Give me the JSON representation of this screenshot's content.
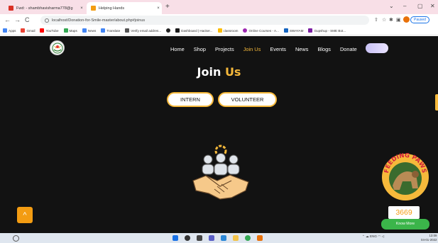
{
  "browser": {
    "tabs": [
      {
        "title": "Fwd: - shambhavisharma778@g",
        "favicon_color": "#d93025",
        "active": false
      },
      {
        "title": "Helping Hands",
        "favicon_color": "#f39c12",
        "active": true
      }
    ],
    "close_glyph": "×",
    "new_tab_glyph": "+",
    "window_controls": [
      "⌄",
      "–",
      "▢",
      "✕"
    ],
    "url": "localhost/Donation-for-Smile-master/about.php#joinus",
    "nav_back": "←",
    "nav_forward": "→",
    "nav_reload": "C",
    "paused_label": "Paused",
    "bookmarks": [
      {
        "label": "Apps",
        "color": "#4285f4"
      },
      {
        "label": "Gmail",
        "color": "#ea4335"
      },
      {
        "label": "YouTube",
        "color": "#ff0000"
      },
      {
        "label": "Maps",
        "color": "#34a853"
      },
      {
        "label": "News",
        "color": "#4285f4"
      },
      {
        "label": "Translate",
        "color": "#4285f4"
      },
      {
        "label": "Verify email addres...",
        "color": "#555555"
      },
      {
        "label": "",
        "color": "#222222"
      },
      {
        "label": "Dashboard | Hacker...",
        "color": "#1a1a1a"
      },
      {
        "label": "classroom",
        "color": "#fbbc04"
      },
      {
        "label": "Online Courses - A...",
        "color": "#9c27b0"
      },
      {
        "label": "SWAYAM",
        "color": "#1565c0"
      },
      {
        "label": "Gupshup - SME Bot...",
        "color": "#7b1fa2"
      }
    ]
  },
  "site": {
    "nav_items": [
      {
        "label": "Home",
        "active": false
      },
      {
        "label": "Shop",
        "active": false
      },
      {
        "label": "Projects",
        "active": false
      },
      {
        "label": "Join Us",
        "active": true
      },
      {
        "label": "Events",
        "active": false
      },
      {
        "label": "News",
        "active": false
      },
      {
        "label": "Blogs",
        "active": false
      },
      {
        "label": "Donate",
        "active": false
      }
    ],
    "headline_word1": "Join",
    "headline_word2": "Us",
    "intern_label": "INTERN",
    "volunteer_label": "VOLUNTEER",
    "scroll_top_glyph": "^",
    "paws_text": "FEEDING PAWS",
    "counter": "3669",
    "know_more": "Know More",
    "accent_color": "#f6b93b"
  },
  "taskbar": {
    "tray_lang": "ENG",
    "tray_region": "IN",
    "clock_time": "13:09",
    "clock_date": "04-01-2022"
  }
}
